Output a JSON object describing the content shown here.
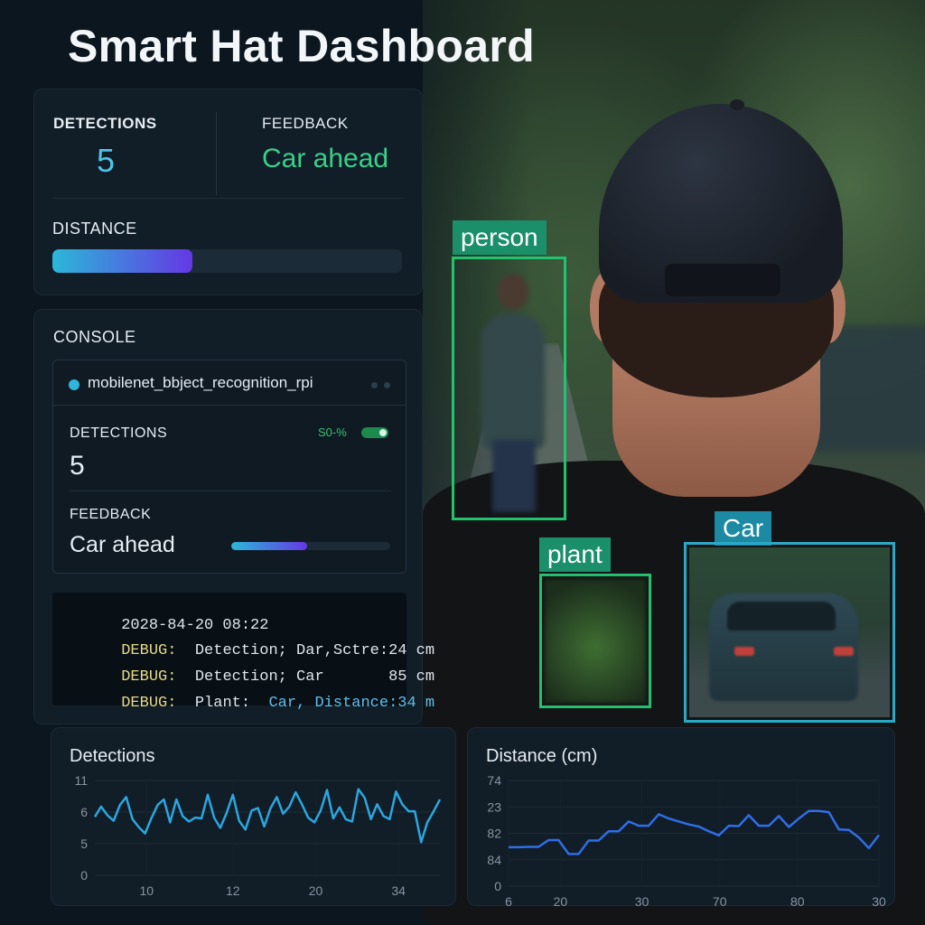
{
  "title": "Smart Hat Dashboard",
  "summary": {
    "detections_label": "DETECTIONS",
    "detections_value": "5",
    "feedback_label": "FEEDBACK",
    "feedback_value": "Car ahead",
    "distance_label": "DISTANCE",
    "distance_fill": 0.4
  },
  "console": {
    "label": "CONSOLE",
    "model_name": "mobilenet_bbject_recognition_rpi",
    "detections_label": "DETECTIONS",
    "detections_value": "5",
    "badge_text": "S0-%",
    "feedback_label": "FEEDBACK",
    "feedback_value": "Car ahead",
    "feedback_fill": 0.48,
    "log": [
      {
        "tag": "",
        "text": "2028-84-20 08:22",
        "style": "plain"
      },
      {
        "tag": "DEBUG:",
        "text": "  Detection; Dar,Sctre:24 cm",
        "style": "plain"
      },
      {
        "tag": "DEBUG:",
        "text": "  Detection; Car       85 cm",
        "style": "plain"
      },
      {
        "tag": "DEBUG:",
        "text": "  Plant:  ",
        "text2": "Car, Distance:34 m",
        "style": "split"
      }
    ]
  },
  "camera": {
    "boxes": [
      {
        "label": "person",
        "color": "green"
      },
      {
        "label": "plant",
        "color": "green"
      },
      {
        "label": "Car",
        "color": "cyan"
      }
    ]
  },
  "chart_data": [
    {
      "type": "line",
      "title": "Detections",
      "y_ticks": [
        "11",
        "6",
        "5",
        "0"
      ],
      "x_ticks": [
        "10",
        "12",
        "20",
        "34"
      ],
      "values": [
        7.4,
        8.7,
        7.6,
        6.9,
        8.9,
        9.9,
        7.1,
        6.1,
        5.3,
        7.2,
        8.9,
        9.6,
        6.7,
        9.6,
        7.5,
        6.8,
        7.3,
        7.2,
        10.2,
        7.3,
        6.0,
        7.9,
        10.2,
        6.9,
        5.8,
        8.2,
        8.5,
        6.2,
        8.5,
        9.9,
        7.8,
        8.7,
        10.5,
        9.0,
        7.3,
        6.7,
        8.2,
        10.8,
        7.2,
        8.6,
        7.1,
        6.8,
        10.9,
        9.8,
        7.1,
        9.0,
        7.5,
        7.1,
        10.6,
        9.0,
        8.1,
        8.1,
        4.2,
        6.7,
        8.1,
        9.6
      ]
    },
    {
      "type": "line",
      "title": "Distance (cm)",
      "y_ticks": [
        "74",
        "23",
        "82",
        "84",
        "0"
      ],
      "x_ticks": [
        "6",
        "20",
        "30",
        "70",
        "80",
        "30"
      ],
      "values": [
        79.2,
        79.2,
        79.3,
        79.3,
        80.9,
        80.9,
        77.6,
        77.6,
        80.8,
        80.8,
        83.0,
        83.0,
        85.3,
        84.3,
        84.3,
        87.0,
        86.0,
        85.3,
        84.6,
        84.1,
        83.0,
        82.0,
        84.3,
        84.2,
        86.8,
        84.3,
        84.3,
        86.6,
        84.0,
        86.0,
        87.8,
        87.8,
        87.5,
        83.4,
        83.3,
        81.5,
        79.0,
        82.1
      ]
    }
  ]
}
